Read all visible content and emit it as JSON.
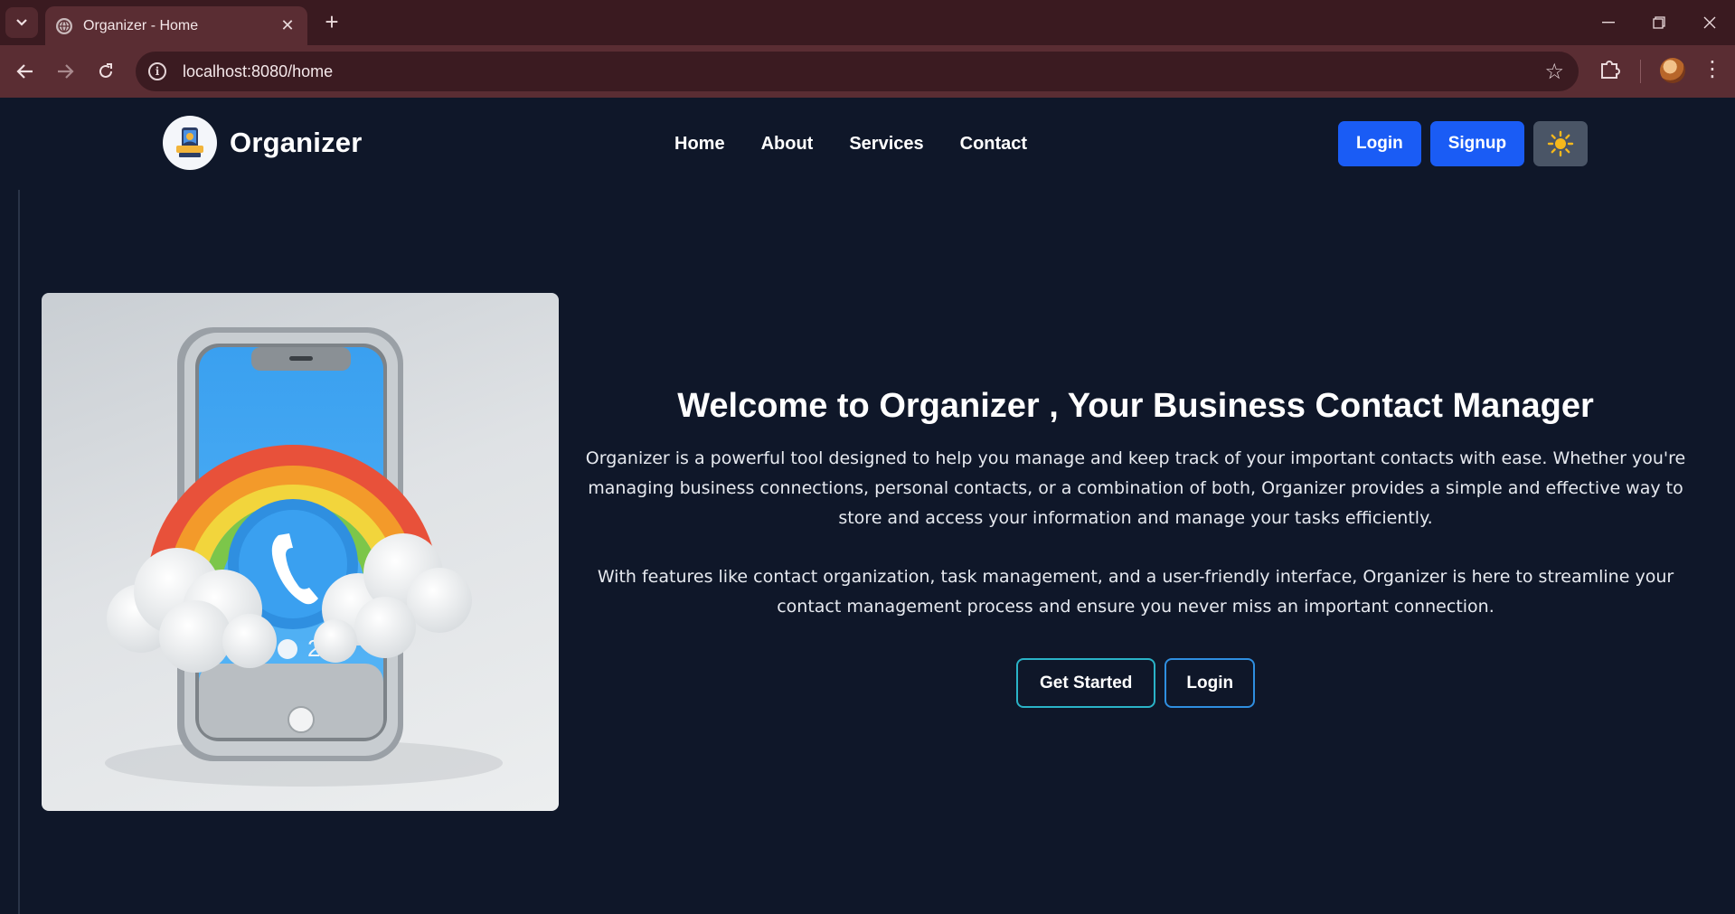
{
  "browser": {
    "tab_title": "Organizer - Home",
    "url": "localhost:8080/home"
  },
  "navbar": {
    "brand": "Organizer",
    "links": [
      "Home",
      "About",
      "Services",
      "Contact"
    ],
    "login_label": "Login",
    "signup_label": "Signup"
  },
  "hero": {
    "title": "Welcome to Organizer , Your Business Contact Manager",
    "paragraph1": "Organizer is a powerful tool designed to help you manage and keep track of your important contacts with ease. Whether you're managing business connections, personal contacts, or a combination of both, Organizer provides a simple and effective way to store and access your information and manage your tasks efficiently.",
    "paragraph2": "With features like contact organization, task management, and a user-friendly interface, Organizer is here to streamline your contact management process and ensure you never miss an important connection.",
    "get_started_label": "Get Started",
    "login_label": "Login"
  },
  "colors": {
    "page_bg": "#0f1729",
    "primary": "#1a5cf5",
    "outline_teal": "#2ab3c7"
  }
}
